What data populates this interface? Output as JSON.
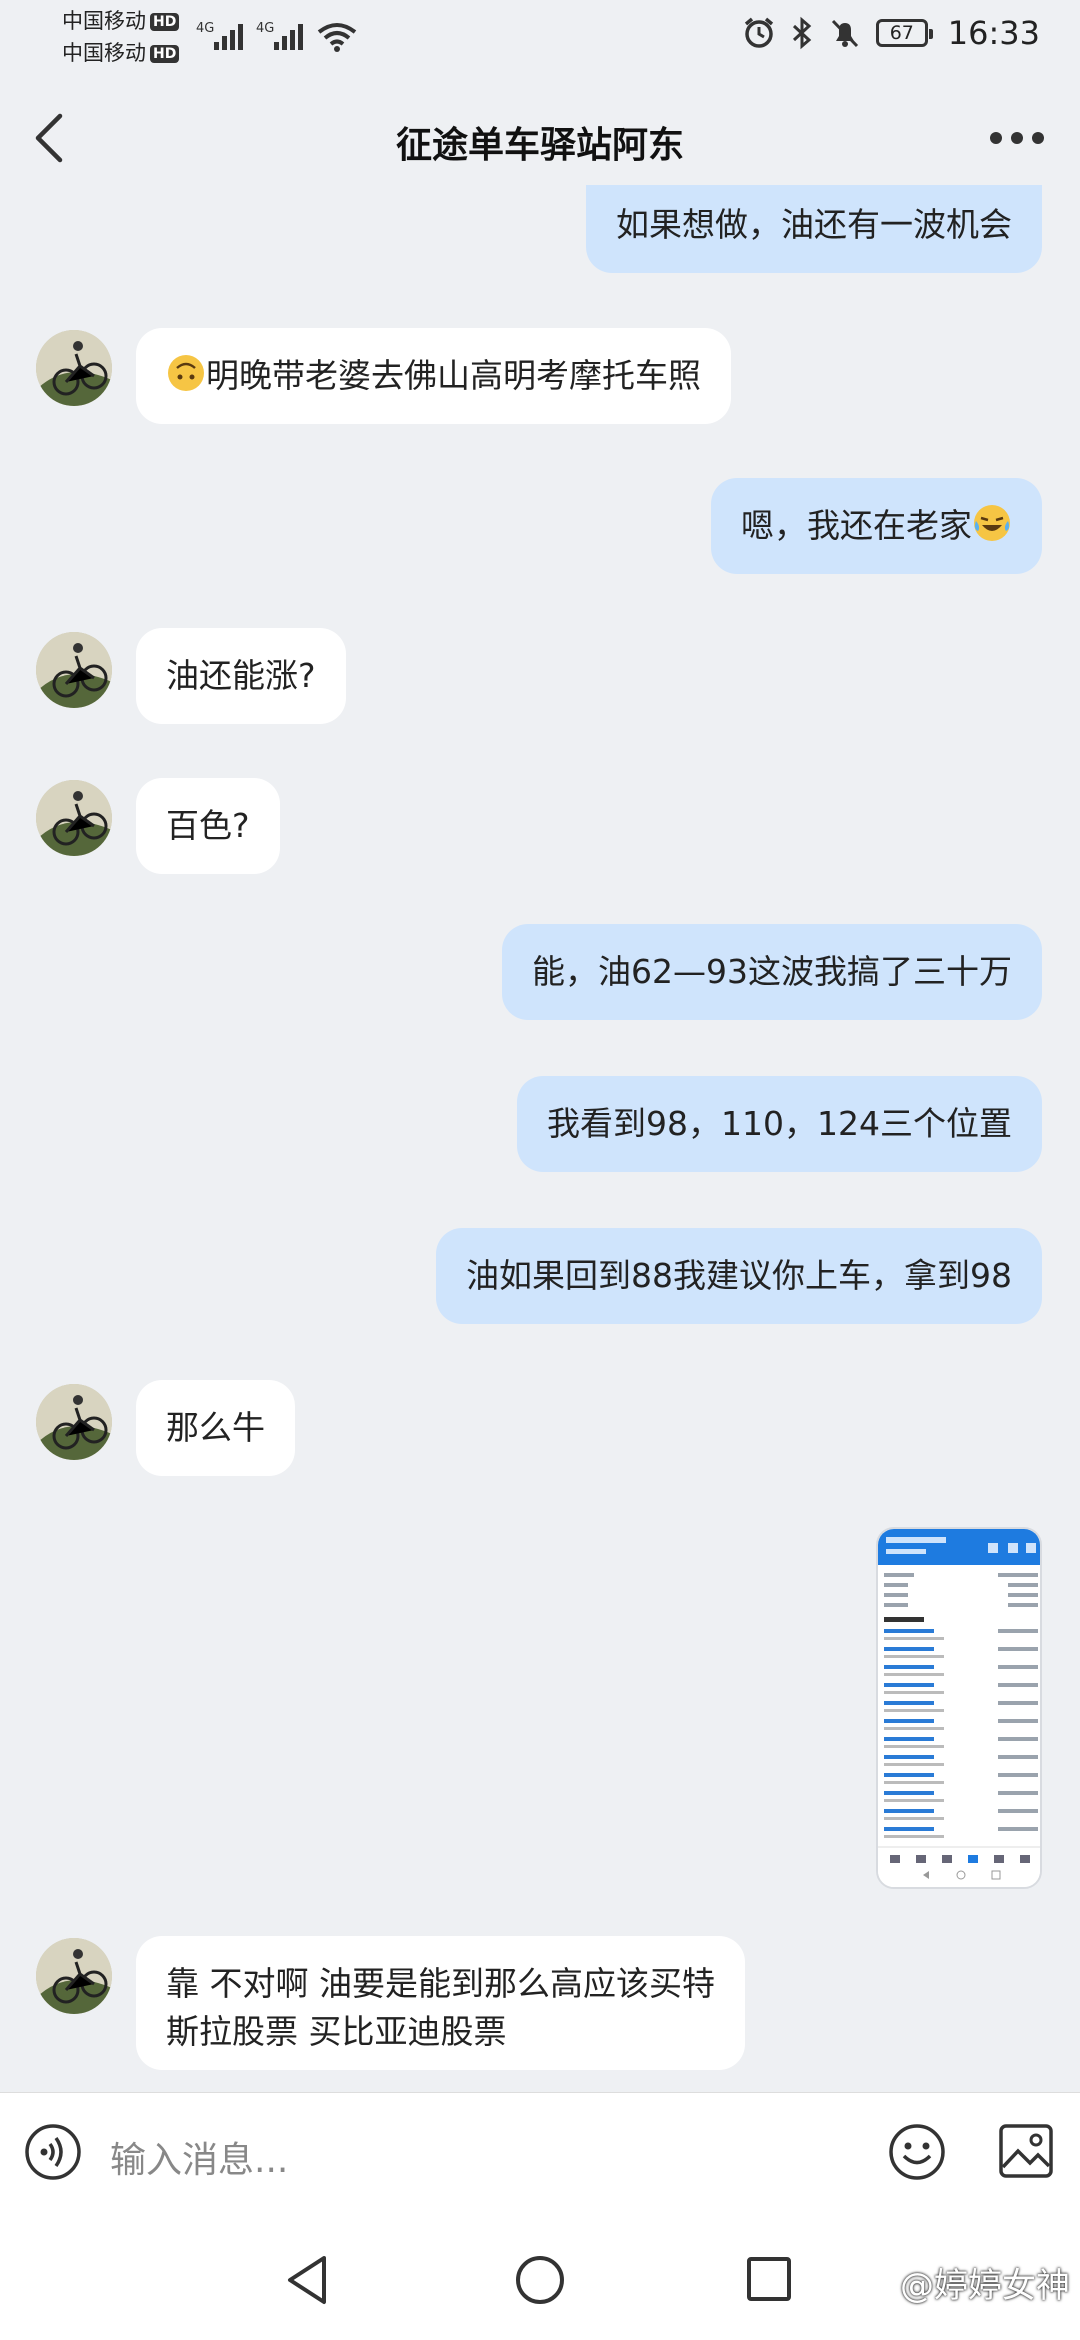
{
  "status_bar": {
    "carrier1": "中国移动",
    "carrier2": "中国移动",
    "hd_label": "HD",
    "net1": "4G",
    "net2": "4G",
    "battery": "67",
    "time": "16:33"
  },
  "header": {
    "title": "征途单车驿站阿东"
  },
  "messages": [
    {
      "side": "right",
      "text": "如果想做，油还有一波机会"
    },
    {
      "side": "left",
      "text": "明晚带老婆去佛山高明考摩托车照",
      "emoji": "upside-down-face"
    },
    {
      "side": "right",
      "text": "嗯，我还在老家",
      "emoji": "tears-of-joy"
    },
    {
      "side": "left",
      "text": "油还能涨?"
    },
    {
      "side": "left",
      "text": "百色?"
    },
    {
      "side": "right",
      "text": "能，油62—93这波我搞了三十万"
    },
    {
      "side": "right",
      "text": "我看到98，110，124三个位置"
    },
    {
      "side": "right",
      "text": "油如果回到88我建议你上车，拿到98"
    },
    {
      "side": "left",
      "text": "那么牛"
    },
    {
      "side": "right",
      "type": "image",
      "content": "trading-app-screenshot"
    },
    {
      "side": "left",
      "text_line1": "靠 不对啊 油要是能到那么高应该买特",
      "text_line2": "斯拉股票 买比亚迪股票"
    }
  ],
  "input_bar": {
    "placeholder": "输入消息..."
  },
  "watermark": "@婷婷女神",
  "colors": {
    "background": "#eef0f3",
    "outgoing_bubble": "#cfe4fc",
    "incoming_bubble": "#ffffff"
  }
}
